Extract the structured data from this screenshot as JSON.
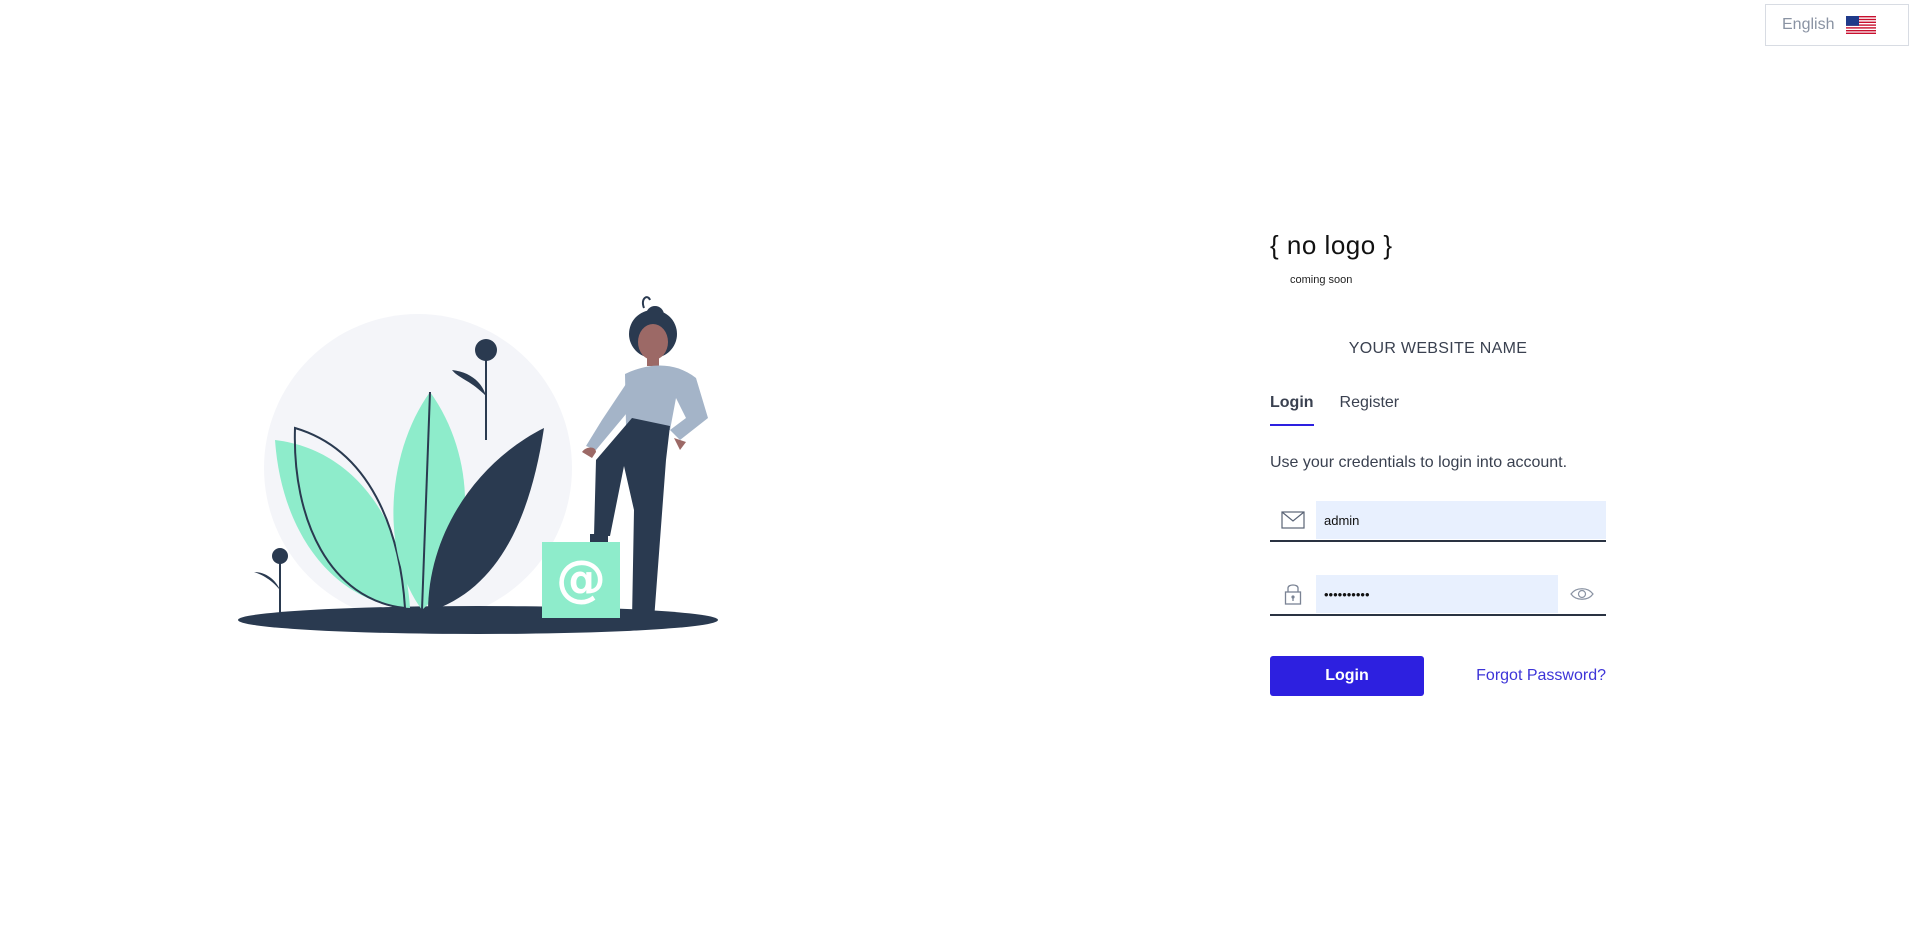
{
  "language": {
    "label": "English",
    "flag": "us-flag-icon"
  },
  "logo": {
    "text": "{ no logo }",
    "subtext": "coming soon"
  },
  "site_name": "YOUR WEBSITE NAME",
  "tabs": [
    {
      "label": "Login",
      "active": true
    },
    {
      "label": "Register",
      "active": false
    }
  ],
  "hint": "Use your credentials to login into account.",
  "email": {
    "value": "admin",
    "icon": "envelope-icon"
  },
  "password": {
    "value": "••••••••••",
    "icon": "lock-icon",
    "toggle_icon": "eye-icon"
  },
  "login_button": "Login",
  "forgot_link": "Forgot Password?",
  "colors": {
    "accent": "#2d20e0",
    "link": "#3d34d8",
    "input_bg": "#e8f0fe",
    "dark": "#2a3a50",
    "mint": "#8eeccb"
  }
}
